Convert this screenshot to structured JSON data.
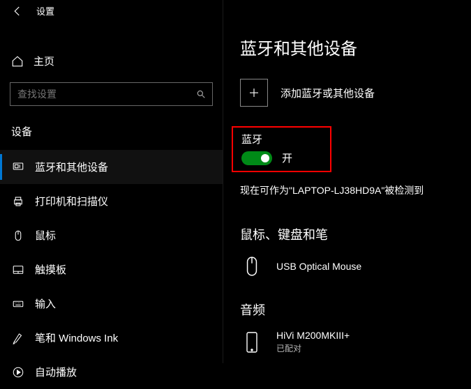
{
  "titlebar": {
    "title": "设置"
  },
  "home": {
    "label": "主页"
  },
  "search": {
    "placeholder": "查找设置"
  },
  "section": {
    "label": "设备"
  },
  "sidebar": {
    "items": [
      {
        "label": "蓝牙和其他设备"
      },
      {
        "label": "打印机和扫描仪"
      },
      {
        "label": "鼠标"
      },
      {
        "label": "触摸板"
      },
      {
        "label": "输入"
      },
      {
        "label": "笔和 Windows Ink"
      },
      {
        "label": "自动播放"
      }
    ]
  },
  "page": {
    "title": "蓝牙和其他设备",
    "add_label": "添加蓝牙或其他设备",
    "bt_heading": "蓝牙",
    "bt_toggle_label": "开",
    "discoverable": "现在可作为\"LAPTOP-LJ38HD9A\"被检测到",
    "mouse_section": "鼠标、键盘和笔",
    "mouse_device": "USB Optical Mouse",
    "audio_section": "音频",
    "audio_device": "HiVi M200MKIII+",
    "audio_status": "已配对"
  }
}
